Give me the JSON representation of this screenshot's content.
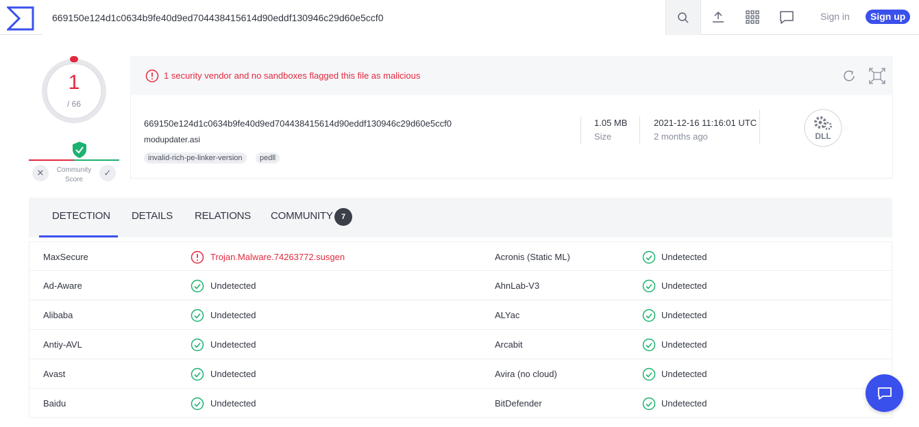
{
  "topbar": {
    "logo_icon": "virustotal-logo",
    "search_value": "669150e124d1c0634b9fe40d9ed704438415614d90eddf130946c29d60e5ccf0",
    "search_icon": "search-icon",
    "upload_icon": "upload-icon",
    "apps_icon": "grid-icon",
    "chat_icon": "chat-icon",
    "signin_label": "Sign in",
    "signup_label": "Sign up"
  },
  "score": {
    "detections": "1",
    "total": "/ 66",
    "community_label_1": "Community",
    "community_label_2": "Score",
    "dislike_glyph": "✕",
    "like_glyph": "✓"
  },
  "summary": {
    "alert": "1 security vendor and no sandboxes flagged this file as malicious",
    "hash": "669150e124d1c0634b9fe40d9ed704438415614d90eddf130946c29d60e5ccf0",
    "filename": "modupdater.asi",
    "tags": [
      "invalid-rich-pe-linker-version",
      "pedll"
    ],
    "size_value": "1.05 MB",
    "size_label": "Size",
    "date_value": "2021-12-16 11:16:01 UTC",
    "date_label": "2 months ago",
    "filetype": "DLL"
  },
  "tabs": [
    {
      "label": "DETECTION"
    },
    {
      "label": "DETAILS"
    },
    {
      "label": "RELATIONS"
    },
    {
      "label": "COMMUNITY",
      "badge": "7"
    }
  ],
  "detections": [
    {
      "vendor1": "MaxSecure",
      "result1": "Trojan.Malware.74263772.susgen",
      "status1": "malicious",
      "vendor2": "Acronis (Static ML)",
      "result2": "Undetected",
      "status2": "clean"
    },
    {
      "vendor1": "Ad-Aware",
      "result1": "Undetected",
      "status1": "clean",
      "vendor2": "AhnLab-V3",
      "result2": "Undetected",
      "status2": "clean"
    },
    {
      "vendor1": "Alibaba",
      "result1": "Undetected",
      "status1": "clean",
      "vendor2": "ALYac",
      "result2": "Undetected",
      "status2": "clean"
    },
    {
      "vendor1": "Antiy-AVL",
      "result1": "Undetected",
      "status1": "clean",
      "vendor2": "Arcabit",
      "result2": "Undetected",
      "status2": "clean"
    },
    {
      "vendor1": "Avast",
      "result1": "Undetected",
      "status1": "clean",
      "vendor2": "Avira (no cloud)",
      "result2": "Undetected",
      "status2": "clean"
    },
    {
      "vendor1": "Baidu",
      "result1": "Undetected",
      "status1": "clean",
      "vendor2": "BitDefender",
      "result2": "Undetected",
      "status2": "clean"
    }
  ],
  "colors": {
    "brand": "#3a50ec",
    "malicious": "#e2293f",
    "clean": "#1db270"
  }
}
